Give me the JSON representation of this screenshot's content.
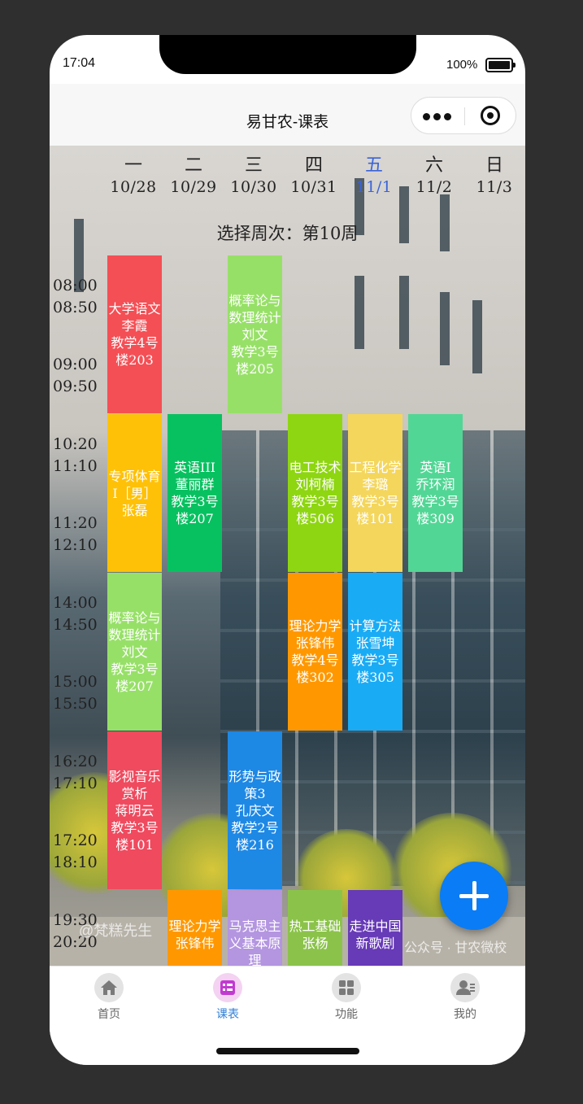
{
  "status_bar": {
    "time": "17:04",
    "battery": "100%"
  },
  "navbar": {
    "title": "易甘农-课表"
  },
  "days": [
    {
      "name": "一",
      "date": "10/28"
    },
    {
      "name": "二",
      "date": "10/29"
    },
    {
      "name": "三",
      "date": "10/30"
    },
    {
      "name": "四",
      "date": "10/31"
    },
    {
      "name": "五",
      "date": "11/1"
    },
    {
      "name": "六",
      "date": "11/2"
    },
    {
      "name": "日",
      "date": "11/3"
    }
  ],
  "today_index": 4,
  "week_select": "选择周次：第10周",
  "times": [
    "08:00",
    "08:50",
    "09:00",
    "09:50",
    "10:20",
    "11:10",
    "11:20",
    "12:10",
    "14:00",
    "14:50",
    "15:00",
    "15:50",
    "16:20",
    "17:10",
    "17:20",
    "18:10",
    "19:30",
    "20:20"
  ],
  "courses": [
    {
      "day": 0,
      "row": 0,
      "text": "大学语文\n李霞\n教学4号楼203",
      "color": "#f44f55"
    },
    {
      "day": 2,
      "row": 0,
      "text": "概率论与数理统计\n刘文\n教学3号楼205",
      "color": "#97e068"
    },
    {
      "day": 0,
      "row": 1,
      "text": "专项体育Ⅰ［男］\n张磊",
      "color": "#ffc107"
    },
    {
      "day": 1,
      "row": 1,
      "text": "英语III\n董丽群\n教学3号楼207",
      "color": "#07c160"
    },
    {
      "day": 3,
      "row": 1,
      "text": "电工技术\n刘柯楠\n教学3号楼506",
      "color": "#8ed611"
    },
    {
      "day": 4,
      "row": 1,
      "text": "工程化学\n李璐\n教学3号楼101",
      "color": "#f4d65c"
    },
    {
      "day": 5,
      "row": 1,
      "text": "英语I\n乔环润\n教学3号楼309",
      "color": "#52d695"
    },
    {
      "day": 0,
      "row": 2,
      "text": "概率论与数理统计\n刘文\n教学3号楼207",
      "color": "#97e068"
    },
    {
      "day": 3,
      "row": 2,
      "text": "理论力学\n张锋伟\n教学4号楼302",
      "color": "#ff9800"
    },
    {
      "day": 4,
      "row": 2,
      "text": "计算方法\n张雪坤\n教学3号楼305",
      "color": "#1aabf5"
    },
    {
      "day": 0,
      "row": 3,
      "text": "影视音乐赏析\n蒋明云\n教学3号楼101",
      "color": "#ef4a5e"
    },
    {
      "day": 2,
      "row": 3,
      "text": "形势与政策3\n孔庆文\n教学2号楼216",
      "color": "#1e88e5"
    },
    {
      "day": 1,
      "row": 4,
      "text": "理论力学\n张锋伟",
      "color": "#ff9800"
    },
    {
      "day": 2,
      "row": 4,
      "text": "马克思主义基本原理",
      "color": "#b395e0"
    },
    {
      "day": 3,
      "row": 4,
      "text": "热工基础\n张杨",
      "color": "#8bc34a"
    },
    {
      "day": 4,
      "row": 4,
      "text": "走进中国新歌剧",
      "color": "#673ab7"
    }
  ],
  "watermarks": {
    "left": "@梵糕先生",
    "right": "公众号 · 甘农微校"
  },
  "tabbar": [
    {
      "label": "首页",
      "icon": "home-icon",
      "active": false
    },
    {
      "label": "课表",
      "icon": "schedule-icon",
      "active": true
    },
    {
      "label": "功能",
      "icon": "grid-icon",
      "active": false
    },
    {
      "label": "我的",
      "icon": "user-icon",
      "active": false
    }
  ]
}
